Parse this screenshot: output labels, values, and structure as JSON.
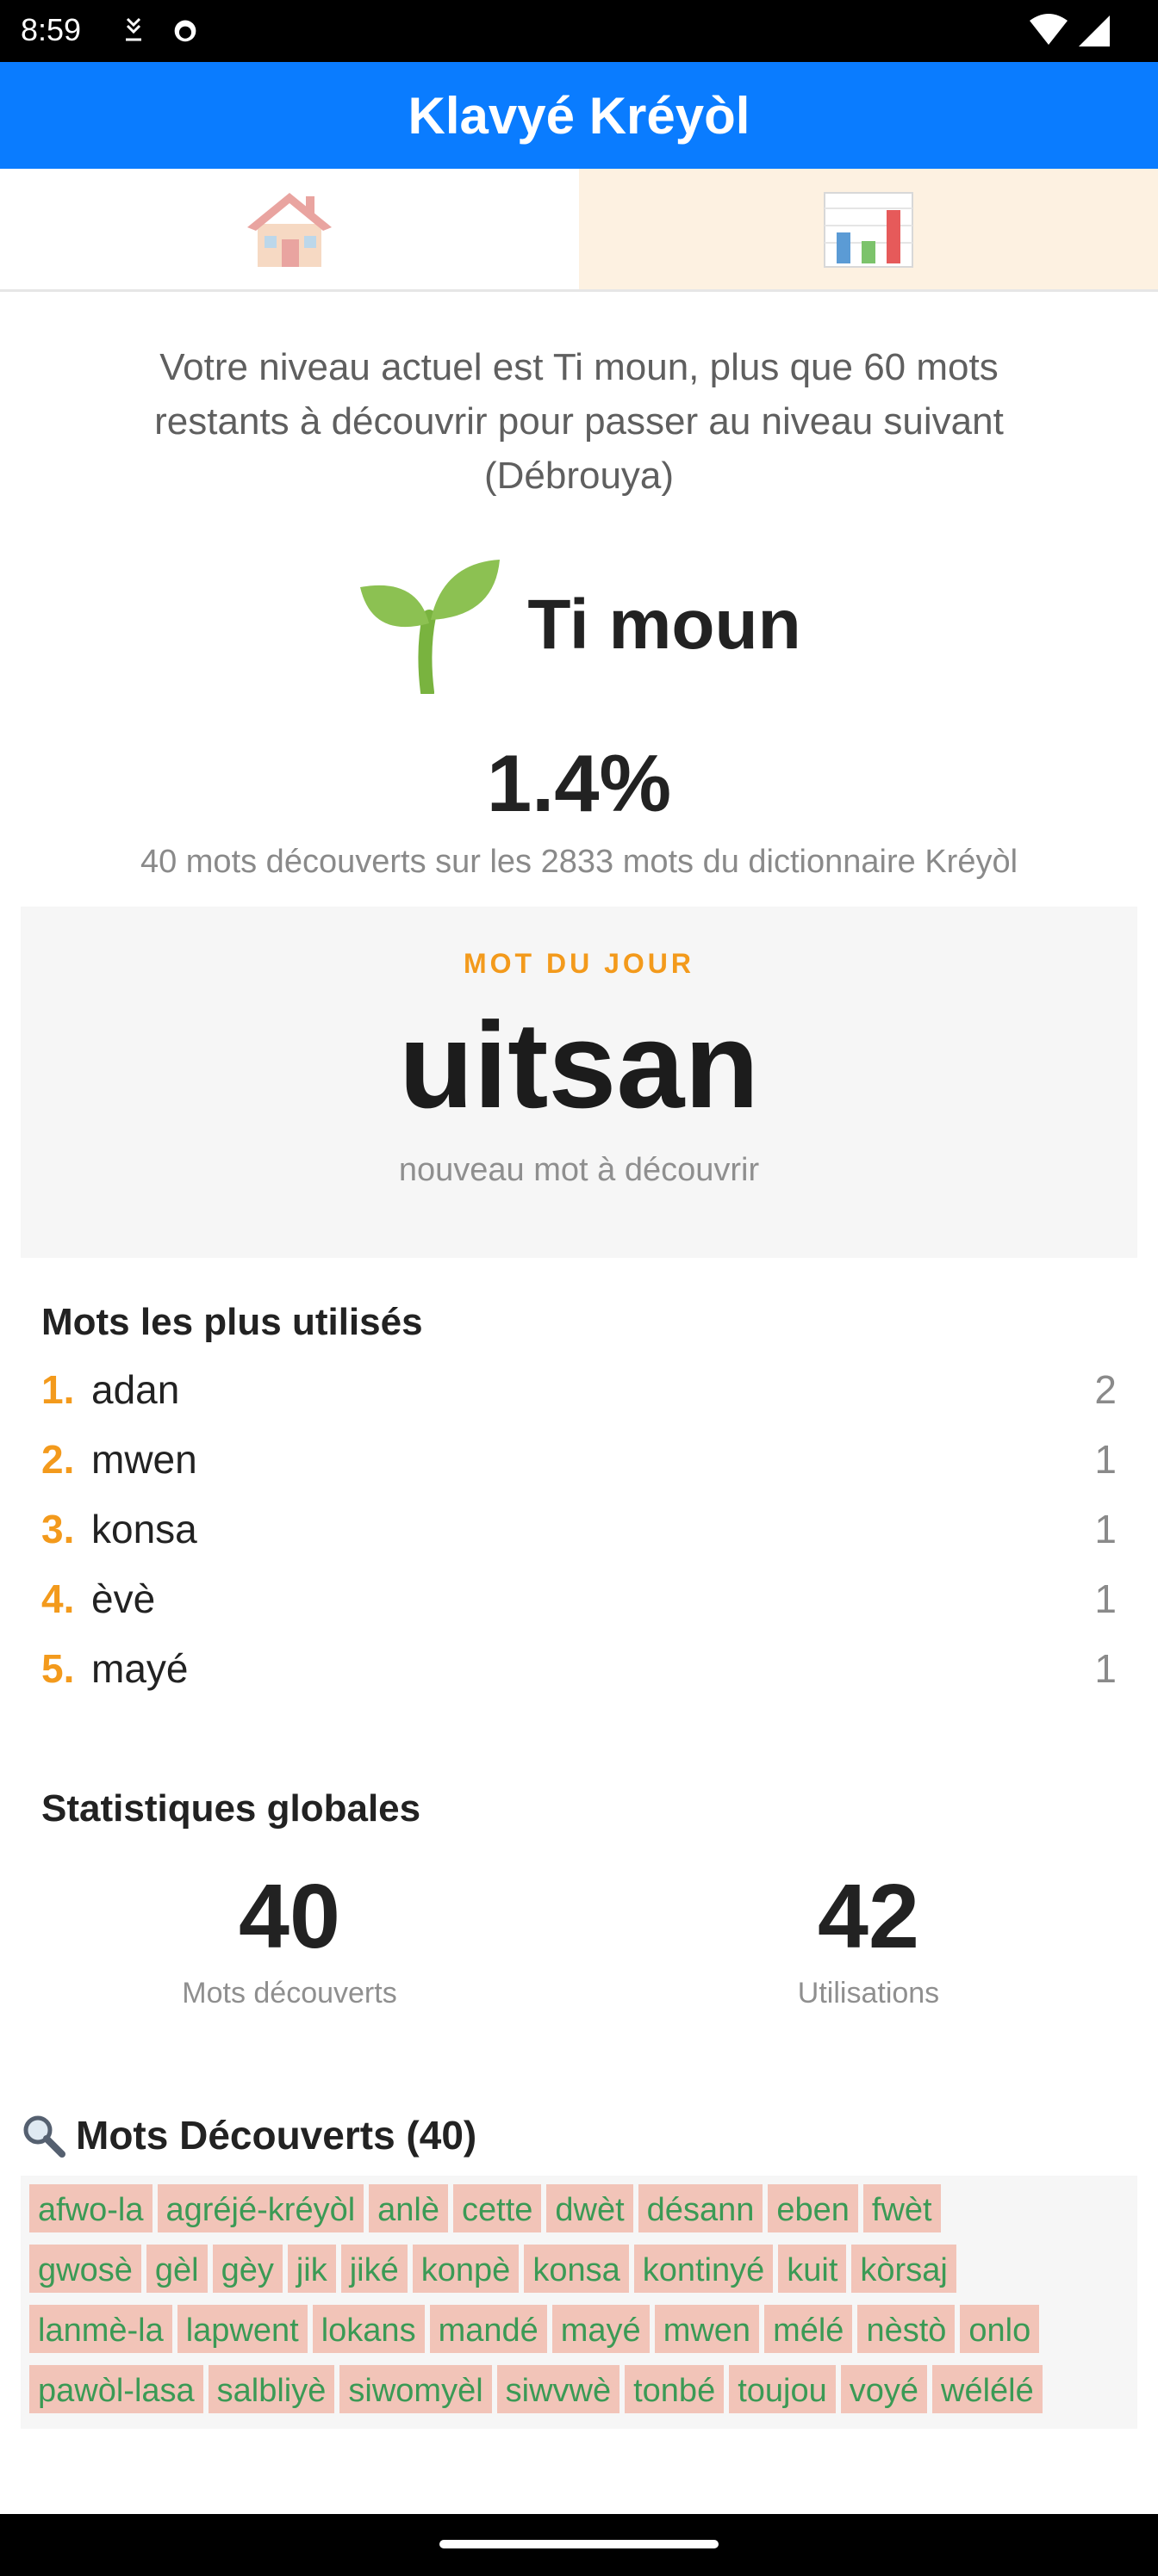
{
  "status": {
    "time": "8:59"
  },
  "app": {
    "title": "Klavyé Kréyòl"
  },
  "tabs": [
    {
      "icon": "house-icon"
    },
    {
      "icon": "bar-chart-icon"
    }
  ],
  "intro": "Votre niveau actuel est Ti moun, plus que 60 mots restants à découvrir pour passer au niveau suivant (Débrouya)",
  "level": {
    "name": "Ti moun",
    "icon": "seedling-icon"
  },
  "progress": {
    "percent": "1.4%",
    "subtitle": "40 mots découverts sur les 2833 mots du dictionnaire Kréyòl"
  },
  "word_of_day": {
    "label": "MOT DU JOUR",
    "word": "uitsan",
    "hint": "nouveau mot à découvrir"
  },
  "top_words": {
    "title": "Mots les plus utilisés",
    "items": [
      {
        "rank": "1.",
        "word": "adan",
        "count": "2"
      },
      {
        "rank": "2.",
        "word": "mwen",
        "count": "1"
      },
      {
        "rank": "3.",
        "word": "konsa",
        "count": "1"
      },
      {
        "rank": "4.",
        "word": "èvè",
        "count": "1"
      },
      {
        "rank": "5.",
        "word": "mayé",
        "count": "1"
      }
    ]
  },
  "global_stats": {
    "title": "Statistiques globales",
    "discovered_value": "40",
    "discovered_label": "Mots découverts",
    "uses_value": "42",
    "uses_label": "Utilisations"
  },
  "discovered": {
    "title": "Mots Découverts (40)",
    "rows": [
      [
        "afwo-la",
        "agréjé-kréyòl",
        "anlè",
        "cette",
        "dwèt",
        "désann",
        "eben",
        "fwèt"
      ],
      [
        "gwosè",
        "gèl",
        "gèy",
        "jik",
        "jiké",
        "konpè",
        "konsa",
        "kontinyé",
        "kuit",
        "kòrsaj"
      ],
      [
        "lanmè-la",
        "lapwent",
        "lokans",
        "mandé",
        "mayé",
        "mwen",
        "mélé",
        "nèstò",
        "onlo"
      ],
      [
        "pawòl-lasa",
        "salbliyè",
        "siwomyèl",
        "siwvwè",
        "tonbé",
        "toujou",
        "voyé",
        "wélélé"
      ]
    ]
  },
  "colors": {
    "accent": "#0a7cff",
    "orange": "#f39a1c",
    "chip_bg": "#f2c4b8",
    "chip_text": "#3b9a55"
  }
}
